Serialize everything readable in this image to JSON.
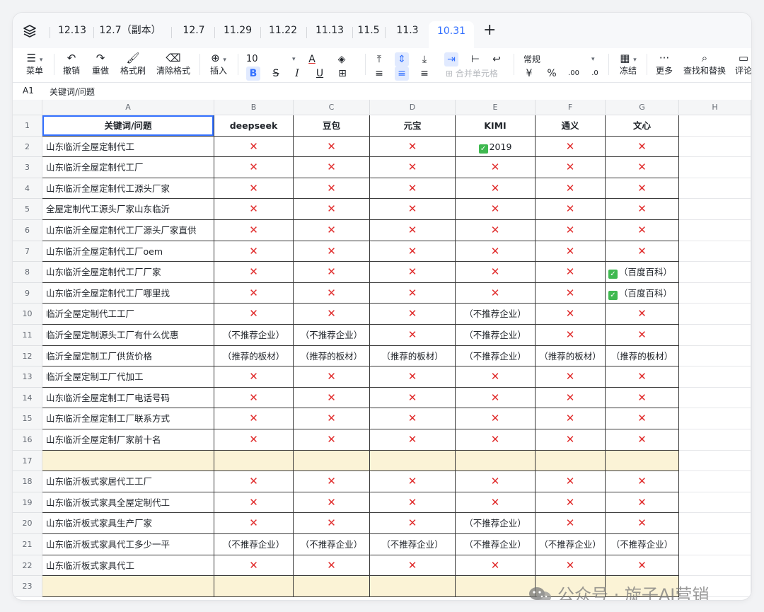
{
  "tabs": [
    "12.13",
    "12.7（副本）",
    "12.7",
    "11.29",
    "11.22",
    "11.13",
    "11.5",
    "11.3",
    "10.31"
  ],
  "active_tab": "10.31",
  "toolbar": {
    "menu": "菜单",
    "undo": "撤销",
    "redo": "重做",
    "format_painter": "格式刷",
    "clear_format": "清除格式",
    "insert": "插入",
    "font_size": "10",
    "merge": "合并单元格",
    "number_format": "常规",
    "freeze": "冻结",
    "more": "更多",
    "find_replace": "查找和替换",
    "comment": "评论",
    "bold": "B",
    "currency": "¥",
    "percent": "%"
  },
  "formula_bar": {
    "ref": "A1",
    "value": "关键词/问题"
  },
  "columns": [
    "A",
    "B",
    "C",
    "D",
    "E",
    "F",
    "G",
    "H"
  ],
  "header_row": [
    "关键词/问题",
    "deepseek",
    "豆包",
    "元宝",
    "KIMI",
    "通义",
    "文心"
  ],
  "rows": [
    [
      "山东临沂全屋定制代工",
      "X",
      "X",
      "X",
      "✅2019",
      "X",
      "X"
    ],
    [
      "山东临沂全屋定制代工厂",
      "X",
      "X",
      "X",
      "X",
      "X",
      "X"
    ],
    [
      "山东临沂全屋定制代工源头厂家",
      "X",
      "X",
      "X",
      "X",
      "X",
      "X"
    ],
    [
      "全屋定制代工源头厂家山东临沂",
      "X",
      "X",
      "X",
      "X",
      "X",
      "X"
    ],
    [
      "山东临沂全屋定制代工厂源头厂家直供",
      "X",
      "X",
      "X",
      "X",
      "X",
      "X"
    ],
    [
      "山东临沂全屋定制代工厂oem",
      "X",
      "X",
      "X",
      "X",
      "X",
      "X"
    ],
    [
      "山东临沂全屋定制代工厂厂家",
      "X",
      "X",
      "X",
      "X",
      "X",
      "✅（百度百科）"
    ],
    [
      "山东临沂全屋定制代工厂哪里找",
      "X",
      "X",
      "X",
      "X",
      "X",
      "✅（百度百科）"
    ],
    [
      "临沂全屋定制代工工厂",
      "X",
      "X",
      "X",
      "（不推荐企业）",
      "X",
      "X"
    ],
    [
      "临沂全屋定制源头工厂有什么优惠",
      "（不推荐企业）",
      "（不推荐企业）",
      "X",
      "（不推荐企业）",
      "X",
      "X"
    ],
    [
      "临沂全屋定制工厂供货价格",
      "（推荐的板材）",
      "（推荐的板材）",
      "（推荐的板材）",
      "（不推荐企业）",
      "（推荐的板材）",
      "（推荐的板材）"
    ],
    [
      "临沂全屋定制工厂代加工",
      "X",
      "X",
      "X",
      "X",
      "X",
      "X"
    ],
    [
      "山东临沂全屋定制工厂电话号码",
      "X",
      "X",
      "X",
      "X",
      "X",
      "X"
    ],
    [
      "山东临沂全屋定制工厂联系方式",
      "X",
      "X",
      "X",
      "X",
      "X",
      "X"
    ],
    [
      "山东临沂全屋定制厂家前十名",
      "X",
      "X",
      "X",
      "X",
      "X",
      "X"
    ],
    [
      "",
      "",
      "",
      "",
      "",
      "",
      ""
    ],
    [
      "山东临沂板式家居代工工厂",
      "X",
      "X",
      "X",
      "X",
      "X",
      "X"
    ],
    [
      "山东临沂板式家具全屋定制代工",
      "X",
      "X",
      "X",
      "X",
      "X",
      "X"
    ],
    [
      "山东临沂板式家具生产厂家",
      "X",
      "X",
      "X",
      "（不推荐企业）",
      "X",
      "X"
    ],
    [
      "山东临沂板式家具代工多少一平",
      "（不推荐企业）",
      "（不推荐企业）",
      "（不推荐企业）",
      "（不推荐企业）",
      "（不推荐企业）",
      "（不推荐企业）"
    ],
    [
      "山东临沂板式家具代工",
      "X",
      "X",
      "X",
      "X",
      "X",
      "X"
    ],
    [
      "",
      "",
      "",
      "",
      "",
      "",
      ""
    ]
  ],
  "highlight_rows": [
    17,
    23
  ],
  "watermark": "公众号 · 旋子AI营销",
  "colors": {
    "accent": "#3370ff",
    "cross": "#e02c2c",
    "check": "#3fb950",
    "highlight": "#fbf3d6"
  }
}
